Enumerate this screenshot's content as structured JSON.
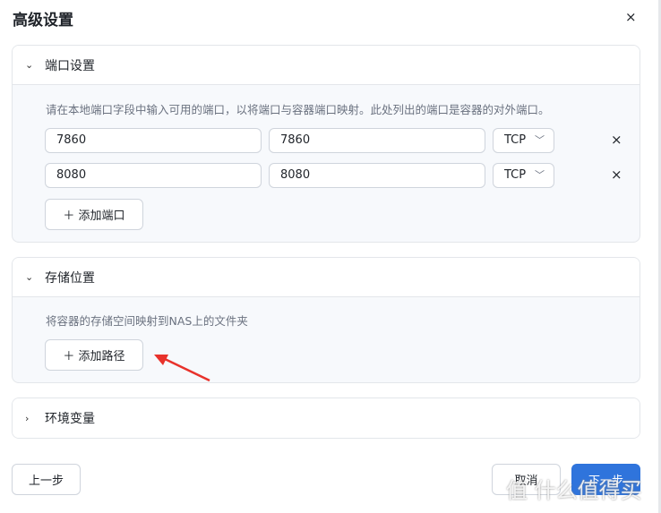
{
  "dialog": {
    "title": "高级设置",
    "close": "×"
  },
  "ports": {
    "header": "端口设置",
    "desc": "请在本地端口字段中输入可用的端口，以将端口与容器端口映射。此处列出的端口是容器的对外端口。",
    "rows": [
      {
        "local": "7860",
        "container": "7860",
        "protocol": "TCP"
      },
      {
        "local": "8080",
        "container": "8080",
        "protocol": "TCP"
      }
    ],
    "add": "＋ 添加端口"
  },
  "storage": {
    "header": "存储位置",
    "desc": "将容器的存储空间映射到NAS上的文件夹",
    "add": "＋ 添加路径"
  },
  "env": {
    "header": "环境变量"
  },
  "footer": {
    "prev": "上一步",
    "cancel": "取消",
    "next": "下一步"
  },
  "watermark": "值 什么值得买",
  "colors": {
    "primary": "#2f74dc",
    "arrow": "#e8322b"
  }
}
